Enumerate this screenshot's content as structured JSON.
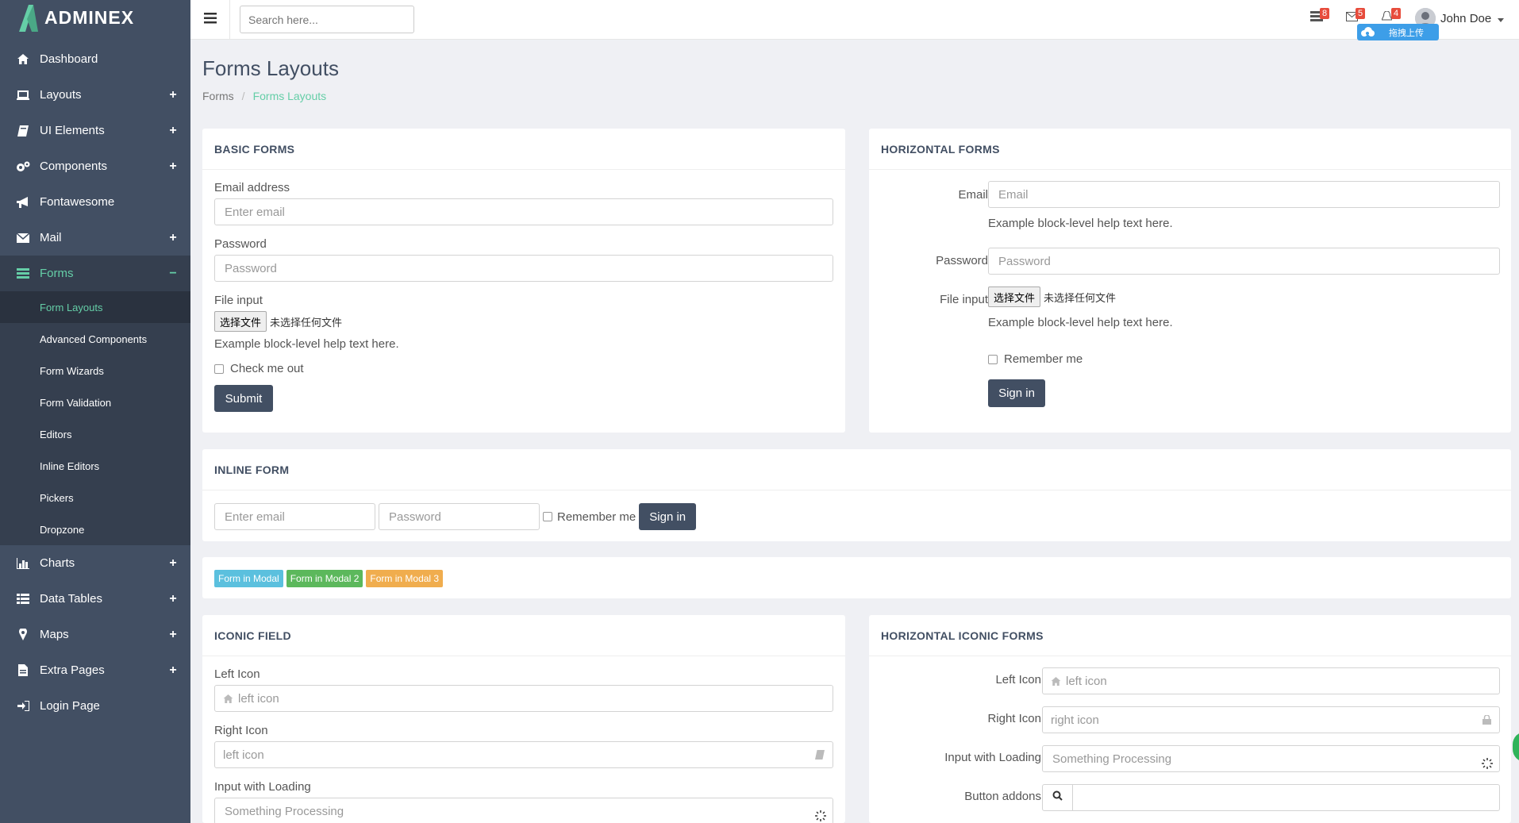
{
  "brand": {
    "name": "ADMINEX"
  },
  "sidebar": {
    "items": [
      {
        "label": "Dashboard",
        "icon": "home-icon",
        "expand": ""
      },
      {
        "label": "Layouts",
        "icon": "laptop-icon",
        "expand": "+"
      },
      {
        "label": "UI Elements",
        "icon": "book-icon",
        "expand": "+"
      },
      {
        "label": "Components",
        "icon": "cogs-icon",
        "expand": "+"
      },
      {
        "label": "Fontawesome",
        "icon": "bullhorn-icon",
        "expand": ""
      },
      {
        "label": "Mail",
        "icon": "envelope-icon",
        "expand": "+"
      },
      {
        "label": "Forms",
        "icon": "tasks-icon",
        "expand": "−"
      },
      {
        "label": "Charts",
        "icon": "bar-chart-icon",
        "expand": "+"
      },
      {
        "label": "Data Tables",
        "icon": "th-list-icon",
        "expand": "+"
      },
      {
        "label": "Maps",
        "icon": "map-marker-icon",
        "expand": "+"
      },
      {
        "label": "Extra Pages",
        "icon": "file-icon",
        "expand": "+"
      },
      {
        "label": "Login Page",
        "icon": "sign-in-icon",
        "expand": ""
      }
    ],
    "forms_sub": [
      "Form Layouts",
      "Advanced Components",
      "Form Wizards",
      "Form Validation",
      "Editors",
      "Inline Editors",
      "Pickers",
      "Dropzone"
    ]
  },
  "topbar": {
    "search_placeholder": "Search here...",
    "badges": {
      "tasks": "8",
      "mail": "5",
      "bell": "4"
    },
    "user": "John Doe",
    "upload_label": "拖拽上传"
  },
  "page": {
    "title": "Forms Layouts",
    "breadcrumb": {
      "parent": "Forms",
      "sep": "/",
      "current": "Forms Layouts"
    }
  },
  "basic_forms": {
    "title": "BASIC FORMS",
    "email_label": "Email address",
    "email_placeholder": "Enter email",
    "password_label": "Password",
    "password_placeholder": "Password",
    "file_label": "File input",
    "file_button": "选择文件",
    "file_status": "未选择任何文件",
    "help": "Example block-level help text here.",
    "check_label": "Check me out",
    "submit": "Submit"
  },
  "horizontal_forms": {
    "title": "HORIZONTAL FORMS",
    "email_label": "Email",
    "email_placeholder": "Email",
    "help": "Example block-level help text here.",
    "password_label": "Password",
    "password_placeholder": "Password",
    "file_label": "File input",
    "file_button": "选择文件",
    "file_status": "未选择任何文件",
    "help2": "Example block-level help text here.",
    "remember": "Remember me",
    "sign_in": "Sign in"
  },
  "inline_form": {
    "title": "INLINE FORM",
    "email_placeholder": "Enter email",
    "password_placeholder": "Password",
    "remember": "Remember me",
    "sign_in": "Sign in"
  },
  "modal_buttons": [
    {
      "label": "Form in Modal",
      "color": "#5bc0de"
    },
    {
      "label": "Form in Modal 2",
      "color": "#5cb85c"
    },
    {
      "label": "Form in Modal 3",
      "color": "#f0ad4e"
    }
  ],
  "iconic_field": {
    "title": "ICONIC FIELD",
    "left_label": "Left Icon",
    "left_placeholder": "left icon",
    "right_label": "Right Icon",
    "right_placeholder": "left icon",
    "loading_label": "Input with Loading",
    "loading_placeholder": "Something Processing"
  },
  "horizontal_iconic": {
    "title": "HORIZONTAL ICONIC FORMS",
    "left_label": "Left Icon",
    "left_placeholder": "left icon",
    "right_label": "Right Icon",
    "right_placeholder": "right icon",
    "loading_label": "Input with Loading",
    "loading_placeholder": "Something Processing",
    "addon_label": "Button addons"
  },
  "colors": {
    "sidebar": "#424f63",
    "accent": "#65cea7",
    "page_bg": "#eff0f4",
    "dark_button": "#424f63"
  }
}
